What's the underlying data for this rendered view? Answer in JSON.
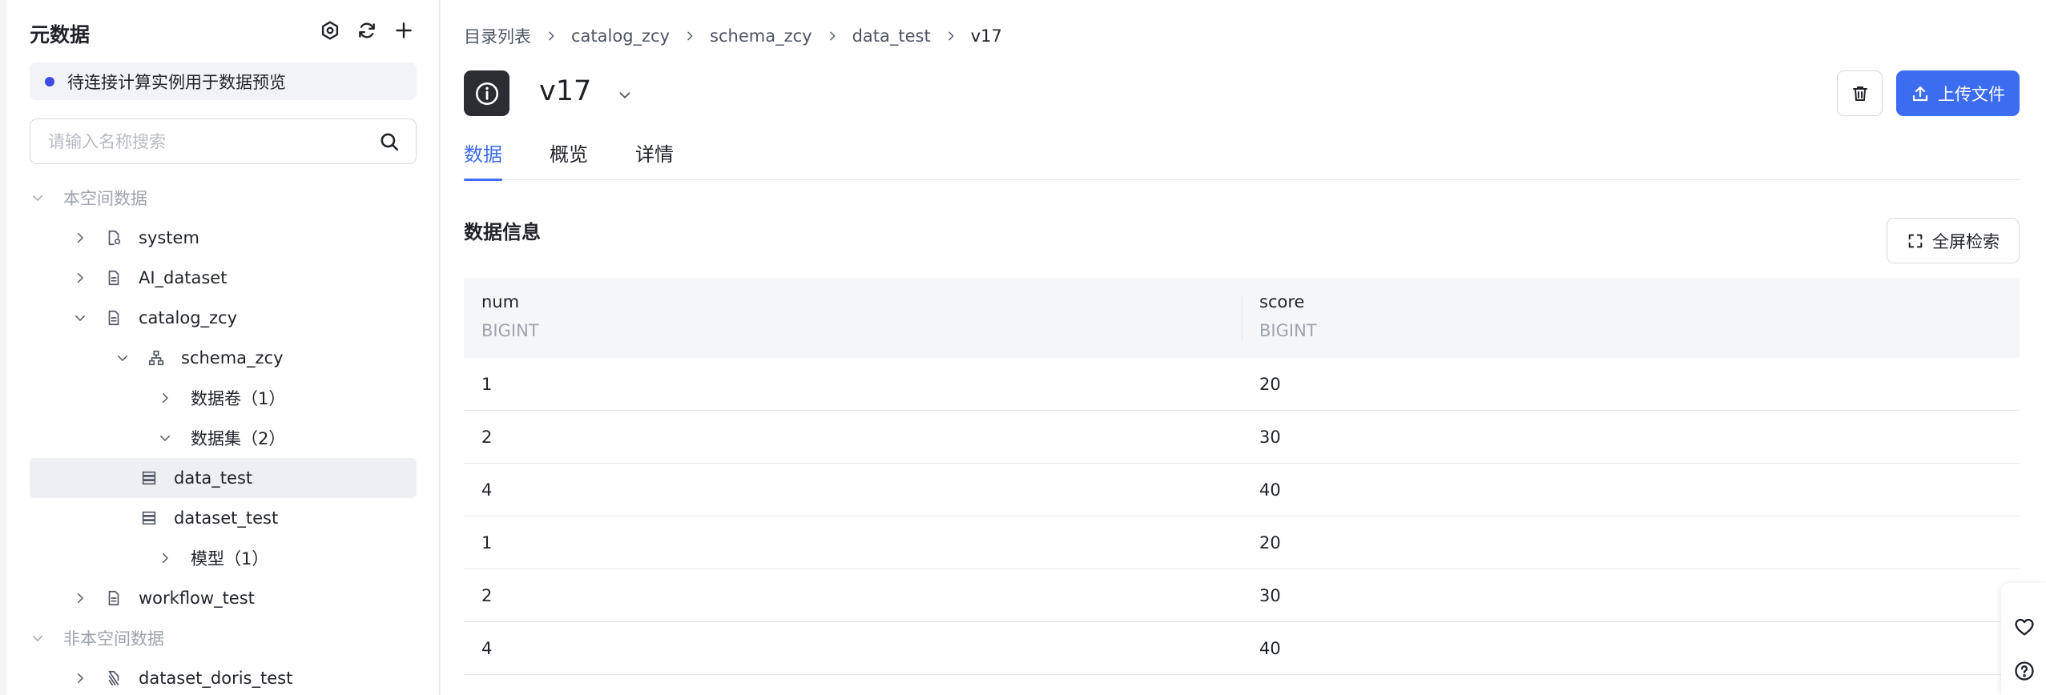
{
  "left_panel": {
    "title": "元数据",
    "notice": "待连接计算实例用于数据预览",
    "search_placeholder": "请输入名称搜索",
    "tree": [
      {
        "label": "本空间数据",
        "depth": 0,
        "expanded": true,
        "icon": "",
        "muted": true
      },
      {
        "label": "system",
        "depth": 1,
        "expanded": false,
        "icon": "catalog-settings-icon"
      },
      {
        "label": "AI_dataset",
        "depth": 1,
        "expanded": false,
        "icon": "catalog-doc-icon"
      },
      {
        "label": "catalog_zcy",
        "depth": 1,
        "expanded": true,
        "icon": "catalog-doc-icon"
      },
      {
        "label": "schema_zcy",
        "depth": 2,
        "expanded": true,
        "icon": "schema-icon"
      },
      {
        "label": "数据卷（1）",
        "depth": 3,
        "expanded": false,
        "icon": ""
      },
      {
        "label": "数据集（2）",
        "depth": 3,
        "expanded": true,
        "icon": ""
      },
      {
        "label": "data_test",
        "depth": 4,
        "icon": "dataset-icon",
        "selected": true
      },
      {
        "label": "dataset_test",
        "depth": 4,
        "icon": "dataset-icon"
      },
      {
        "label": "模型（1）",
        "depth": 3,
        "expanded": false,
        "icon": ""
      },
      {
        "label": "workflow_test",
        "depth": 1,
        "expanded": false,
        "icon": "catalog-doc-icon"
      },
      {
        "label": "非本空间数据",
        "depth": 0,
        "expanded": true,
        "icon": "",
        "muted": true
      },
      {
        "label": "dataset_doris_test",
        "depth": 1,
        "expanded": false,
        "icon": "doris-icon"
      }
    ]
  },
  "main": {
    "breadcrumb": [
      "目录列表",
      "catalog_zcy",
      "schema_zcy",
      "data_test",
      "v17"
    ],
    "title": "v17",
    "upload_label": "上传文件",
    "tabs": [
      {
        "label": "数据",
        "active": true
      },
      {
        "label": "概览",
        "active": false
      },
      {
        "label": "详情",
        "active": false
      }
    ],
    "section_title": "数据信息",
    "fullscreen_label": "全屏检索",
    "table": {
      "columns": [
        {
          "name": "num",
          "type": "BIGINT"
        },
        {
          "name": "score",
          "type": "BIGINT"
        }
      ],
      "rows": [
        [
          "1",
          "20"
        ],
        [
          "2",
          "30"
        ],
        [
          "4",
          "40"
        ],
        [
          "1",
          "20"
        ],
        [
          "2",
          "30"
        ],
        [
          "4",
          "40"
        ]
      ]
    }
  },
  "colors": {
    "accent": "#3c6df0",
    "notice_dot": "#3d4be0",
    "selected_row": "#eeeff2"
  }
}
